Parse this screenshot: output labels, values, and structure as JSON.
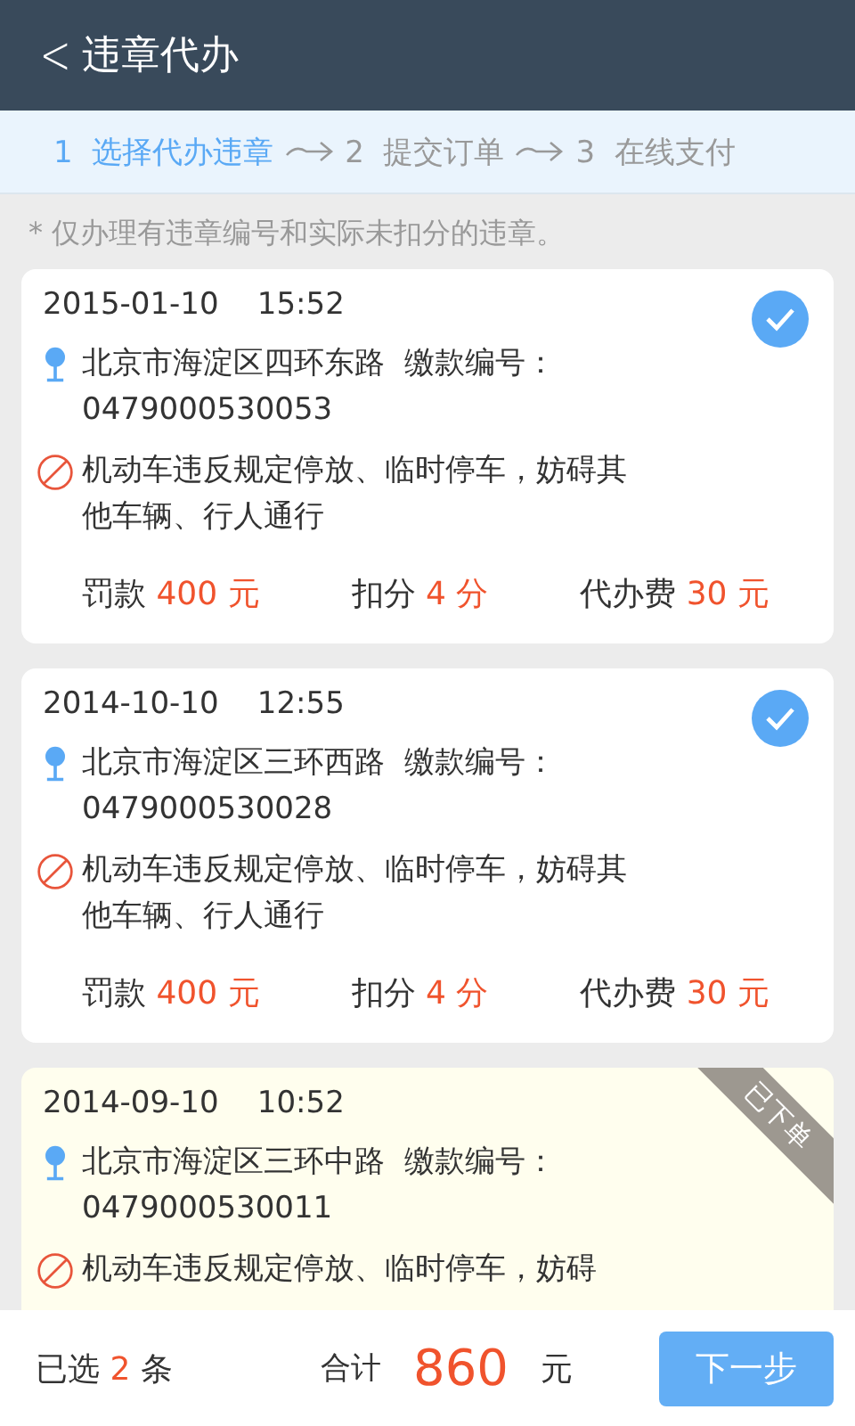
{
  "header": {
    "back": "<",
    "title": "违章代办"
  },
  "steps": [
    {
      "label": "1  选择代办违章",
      "selected": true
    },
    {
      "label": "2  提交订单",
      "selected": false
    },
    {
      "label": "3  在线支付",
      "selected": false
    }
  ],
  "note": "* 仅办理有违章编号和实际未扣分的违章。",
  "violations": [
    {
      "kind": "selectable",
      "checked": true,
      "datetime": "2015-01-10    15:52",
      "location": "北京市海淀区四环东路  缴款编号：",
      "number": "0479000530053",
      "description": "机动车违反规定停放、临时停车，妨碍其他车辆、行人通行",
      "fees": [
        {
          "label": "罚款",
          "value": "400 元"
        },
        {
          "label": "扣分",
          "value": "4 分"
        },
        {
          "label": "代办费",
          "value": "30 元"
        }
      ]
    },
    {
      "kind": "selectable",
      "checked": true,
      "datetime": "2014-10-10    12:55",
      "location": "北京市海淀区三环西路  缴款编号：",
      "number": "0479000530028",
      "description": "机动车违反规定停放、临时停车，妨碍其他车辆、行人通行",
      "fees": [
        {
          "label": "罚款",
          "value": "400 元"
        },
        {
          "label": "扣分",
          "value": "4 分"
        },
        {
          "label": "代办费",
          "value": "30 元"
        }
      ]
    },
    {
      "kind": "ordered",
      "badge": "已下单",
      "datetime": "2014-09-10    10:52",
      "location": "北京市海淀区三环中路  缴款编号：",
      "number": "0479000530011",
      "description": "机动车违反规定停放、临时停车，妨碍"
    }
  ],
  "footer": {
    "selected_prefix": "已选",
    "selected_count": "2",
    "selected_suffix": "条",
    "total_label": "合计",
    "total": "860",
    "total_unit": "元",
    "next_button": "下一步"
  }
}
